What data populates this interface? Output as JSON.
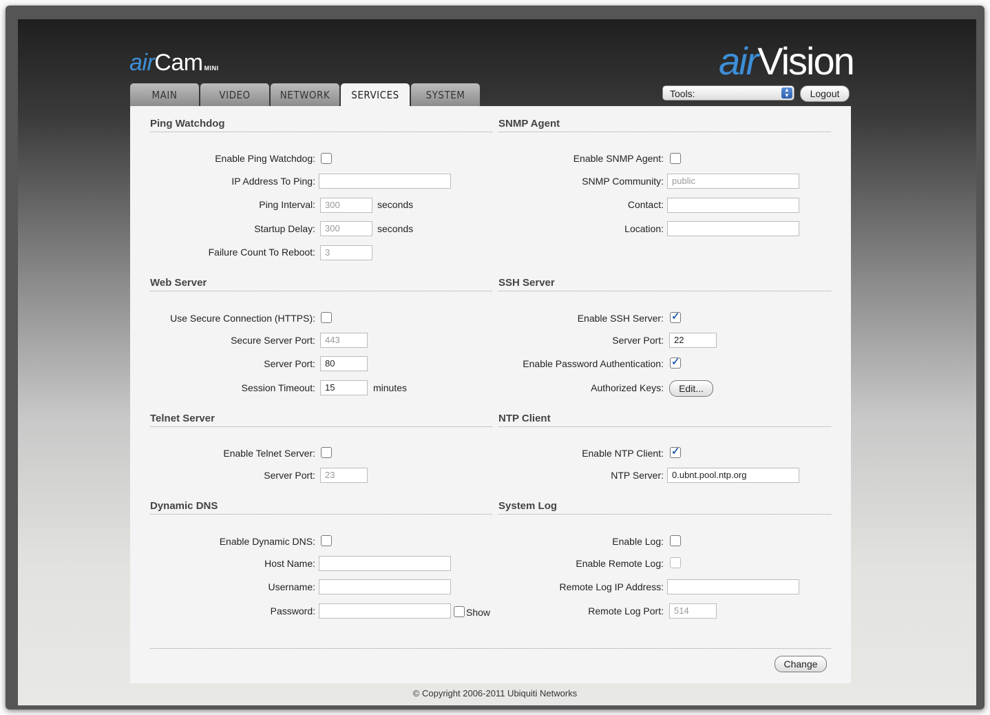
{
  "header": {
    "logo_left_air": "air",
    "logo_left_cam": "Cam",
    "logo_left_mini": "MINI",
    "logo_right_air": "air",
    "logo_right_vision": "Vision",
    "tools_label": "Tools:",
    "logout_label": "Logout"
  },
  "tabs": [
    "MAIN",
    "VIDEO",
    "NETWORK",
    "SERVICES",
    "SYSTEM"
  ],
  "active_tab": "SERVICES",
  "ping": {
    "title": "Ping Watchdog",
    "enable_label": "Enable Ping Watchdog:",
    "enable_checked": false,
    "ip_label": "IP Address To Ping:",
    "ip_value": "",
    "interval_label": "Ping Interval:",
    "interval_value": "300",
    "interval_unit": "seconds",
    "delay_label": "Startup Delay:",
    "delay_value": "300",
    "delay_unit": "seconds",
    "fail_label": "Failure Count To Reboot:",
    "fail_value": "3"
  },
  "snmp": {
    "title": "SNMP Agent",
    "enable_label": "Enable SNMP Agent:",
    "enable_checked": false,
    "community_label": "SNMP Community:",
    "community_value": "public",
    "contact_label": "Contact:",
    "contact_value": "",
    "location_label": "Location:",
    "location_value": ""
  },
  "web": {
    "title": "Web Server",
    "https_label": "Use Secure Connection (HTTPS):",
    "https_checked": false,
    "secure_port_label": "Secure Server Port:",
    "secure_port_value": "443",
    "port_label": "Server Port:",
    "port_value": "80",
    "timeout_label": "Session Timeout:",
    "timeout_value": "15",
    "timeout_unit": "minutes"
  },
  "ssh": {
    "title": "SSH Server",
    "enable_label": "Enable SSH Server:",
    "enable_checked": true,
    "port_label": "Server Port:",
    "port_value": "22",
    "pwauth_label": "Enable Password Authentication:",
    "pwauth_checked": true,
    "keys_label": "Authorized Keys:",
    "edit_label": "Edit..."
  },
  "telnet": {
    "title": "Telnet Server",
    "enable_label": "Enable Telnet Server:",
    "enable_checked": false,
    "port_label": "Server Port:",
    "port_value": "23"
  },
  "ntp": {
    "title": "NTP Client",
    "enable_label": "Enable NTP Client:",
    "enable_checked": true,
    "server_label": "NTP Server:",
    "server_value": "0.ubnt.pool.ntp.org"
  },
  "ddns": {
    "title": "Dynamic DNS",
    "enable_label": "Enable Dynamic DNS:",
    "enable_checked": false,
    "host_label": "Host Name:",
    "host_value": "",
    "user_label": "Username:",
    "user_value": "",
    "pass_label": "Password:",
    "pass_value": "",
    "show_label": "Show"
  },
  "syslog": {
    "title": "System Log",
    "enable_label": "Enable Log:",
    "enable_checked": false,
    "remote_label": "Enable Remote Log:",
    "remote_checked": false,
    "ip_label": "Remote Log IP Address:",
    "ip_value": "",
    "port_label": "Remote Log Port:",
    "port_value": "514"
  },
  "footer": {
    "change_label": "Change",
    "copyright": "© Copyright 2006-2011 Ubiquiti Networks"
  }
}
